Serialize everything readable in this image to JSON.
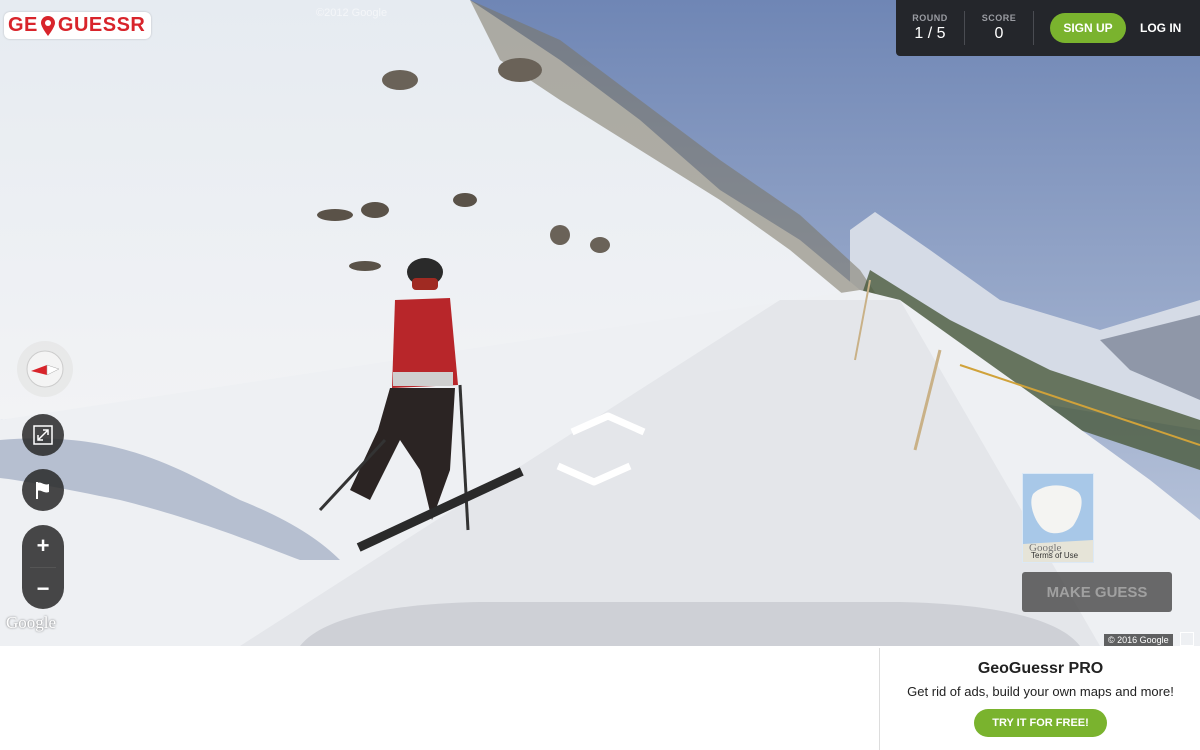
{
  "header": {
    "logo_text_left": "GE",
    "logo_text_right": "GUESSR",
    "round_label": "ROUND",
    "round_value": "1 / 5",
    "score_label": "SCORE",
    "score_value": "0",
    "signup_label": "SIGN UP",
    "login_label": "LOG IN"
  },
  "viewer": {
    "top_watermark": "©2012 Google",
    "google_logo": "Google",
    "copyright": "© 2016 Google",
    "minimap_terms": "Terms of Use",
    "minimap_google": "Google",
    "make_guess_label": "MAKE GUESS"
  },
  "controls": {
    "compass": "compass-icon",
    "fullscreen": "collapse-arrows-icon",
    "flag": "flag-icon",
    "zoom_in": "+",
    "zoom_out": "−"
  },
  "promo": {
    "title": "GeoGuessr PRO",
    "subtitle": "Get rid of ads, build your own maps and more!",
    "button_label": "TRY IT FOR FREE!"
  },
  "colors": {
    "brand_red": "#d8242b",
    "accent_green": "#7ab32e",
    "header_bg": "#24262b"
  }
}
